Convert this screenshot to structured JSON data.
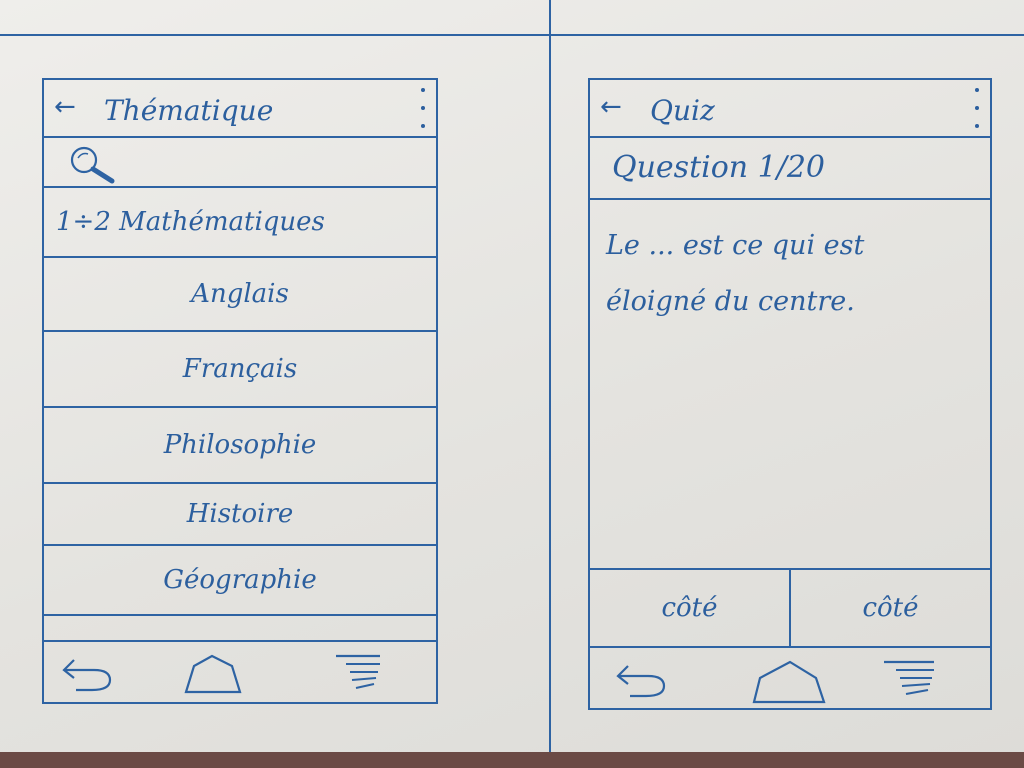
{
  "left_screen": {
    "title": "Thématique",
    "back_icon": "back-arrow-icon",
    "menu_icon": "kebab-menu-icon",
    "search_icon": "search-icon",
    "items": [
      {
        "label": "1÷2 Mathématiques"
      },
      {
        "label": "Anglais"
      },
      {
        "label": "Français"
      },
      {
        "label": "Philosophie"
      },
      {
        "label": "Histoire"
      },
      {
        "label": "Géographie"
      }
    ]
  },
  "right_screen": {
    "title": "Quiz",
    "back_icon": "back-arrow-icon",
    "menu_icon": "kebab-menu-icon",
    "question_counter": "Question 1/20",
    "question_text_line1": "Le ... est ce qui est",
    "question_text_line2": "éloigné du centre.",
    "answers": [
      {
        "label": "côté"
      },
      {
        "label": "côté"
      }
    ]
  },
  "navbar": {
    "back_icon": "undo-back-icon",
    "home_icon": "home-icon",
    "menu_icon": "hamburger-menu-icon"
  },
  "colors": {
    "ink": "#2c5f9e",
    "paper": "#efeeeb"
  }
}
